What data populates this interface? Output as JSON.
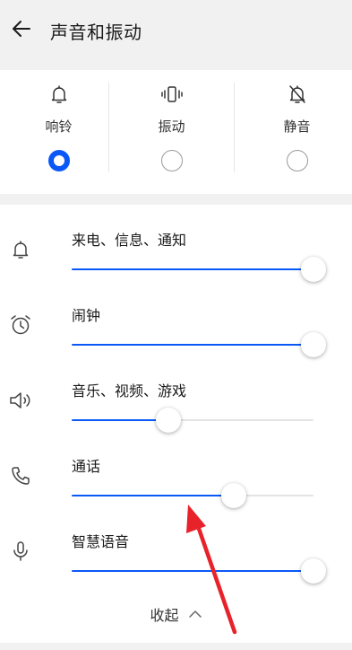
{
  "header": {
    "title": "声音和振动",
    "back_icon": "arrow-left-icon"
  },
  "modes": [
    {
      "label": "响铃",
      "icon": "bell-icon",
      "checked": true
    },
    {
      "label": "振动",
      "icon": "vibrate-icon",
      "checked": false
    },
    {
      "label": "静音",
      "icon": "bell-off-icon",
      "checked": false
    }
  ],
  "volumes": [
    {
      "label": "来电、信息、通知",
      "icon": "bell-icon",
      "level_percent": 100
    },
    {
      "label": "闹钟",
      "icon": "alarm-clock-icon",
      "level_percent": 100
    },
    {
      "label": "音乐、视频、游戏",
      "icon": "speaker-icon",
      "level_percent": 40
    },
    {
      "label": "通话",
      "icon": "phone-icon",
      "level_percent": 67
    },
    {
      "label": "智慧语音",
      "icon": "microphone-icon",
      "level_percent": 100
    }
  ],
  "collapse": {
    "label": "收起",
    "icon": "chevron-up-icon"
  },
  "colors": {
    "accent": "#0a59f7",
    "annotation_arrow": "#e8222a",
    "background": "#f1f1f1"
  }
}
